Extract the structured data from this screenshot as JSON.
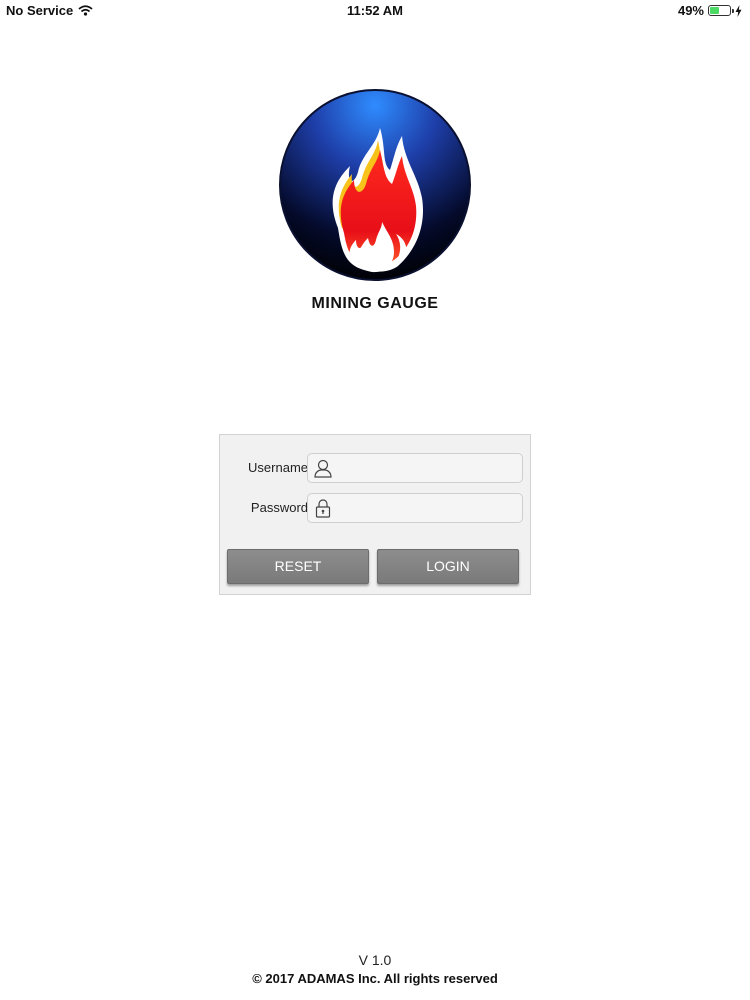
{
  "status_bar": {
    "carrier": "No Service",
    "time": "11:52 AM",
    "battery": "49%",
    "battery_level": 0.49,
    "wifi_icon": "wifi-icon",
    "battery_icon": "battery-icon",
    "charging_icon": "charging-bolt-icon"
  },
  "app": {
    "title": "MINING GAUGE",
    "logo_icon": "flame-logo-icon"
  },
  "login": {
    "username_label": "Username",
    "username_value": "",
    "username_icon": "user-icon",
    "password_label": "Password",
    "password_value": "",
    "password_icon": "lock-icon",
    "reset_label": "RESET",
    "login_label": "LOGIN"
  },
  "footer": {
    "version": "V 1.0",
    "copyright": "© 2017 ADAMAS Inc. All rights reserved"
  },
  "colors": {
    "button_gray": "#808080",
    "panel_bg": "#f1f1f1",
    "battery_green": "#4cd964"
  }
}
